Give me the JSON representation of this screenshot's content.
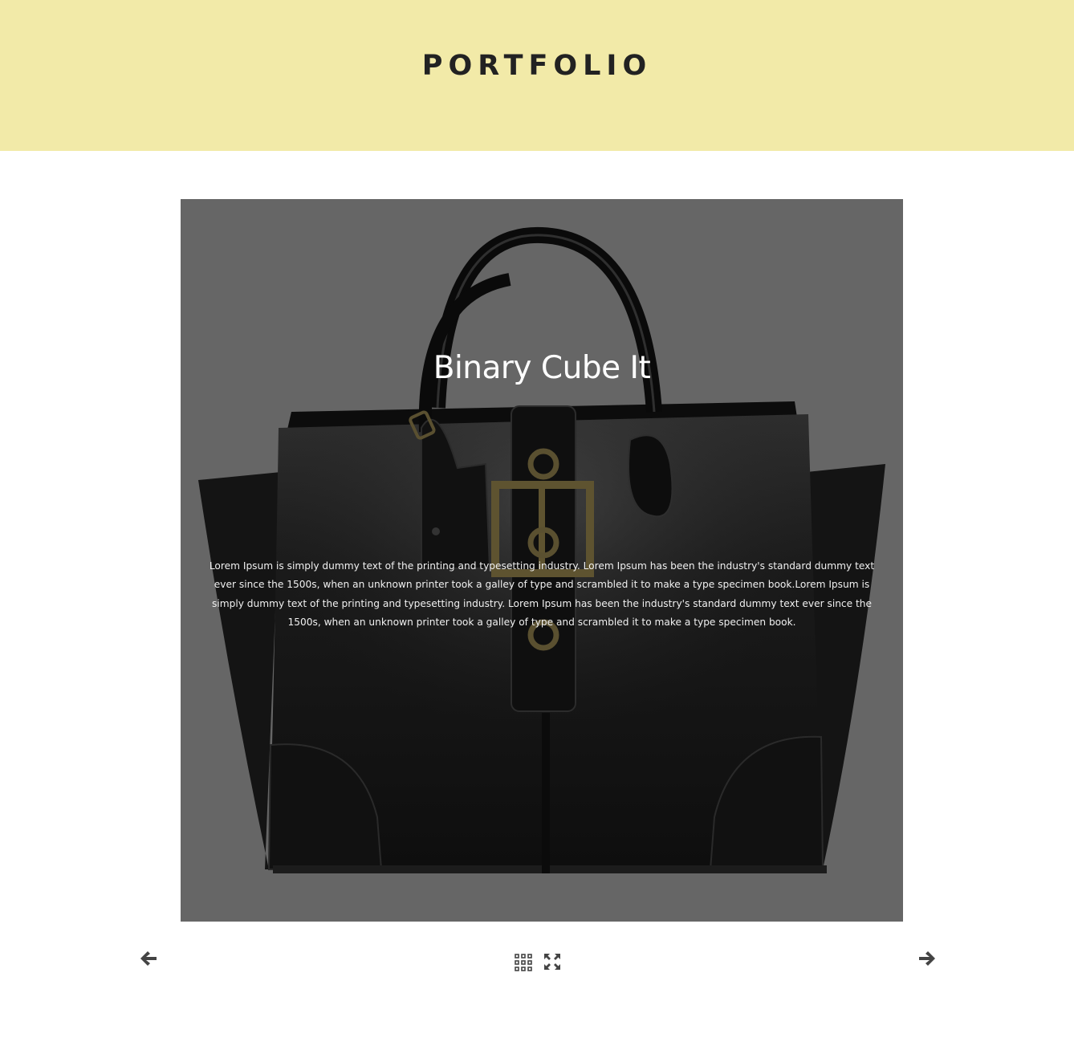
{
  "header": {
    "title": "PORTFOLIO",
    "background": "#f2eaa8"
  },
  "slide": {
    "title": "Binary Cube It",
    "description": "Lorem Ipsum is simply dummy text of the printing and typesetting industry. Lorem Ipsum has been the industry's standard dummy text ever since the 1500s, when an unknown printer took a galley of type and scrambled it to make a type specimen book.Lorem Ipsum is simply dummy text of the printing and typesetting industry. Lorem Ipsum has been the industry's standard dummy text ever since the 1500s, when an unknown printer took a galley of type and scrambled it to make a type specimen book.",
    "image": "black-leather-handbag",
    "overlay_color": "#666666"
  },
  "controls": {
    "prev_icon": "arrow-left-icon",
    "next_icon": "arrow-right-icon",
    "grid_icon": "grid-icon",
    "fullscreen_icon": "fullscreen-icon",
    "icon_color": "#444444"
  }
}
